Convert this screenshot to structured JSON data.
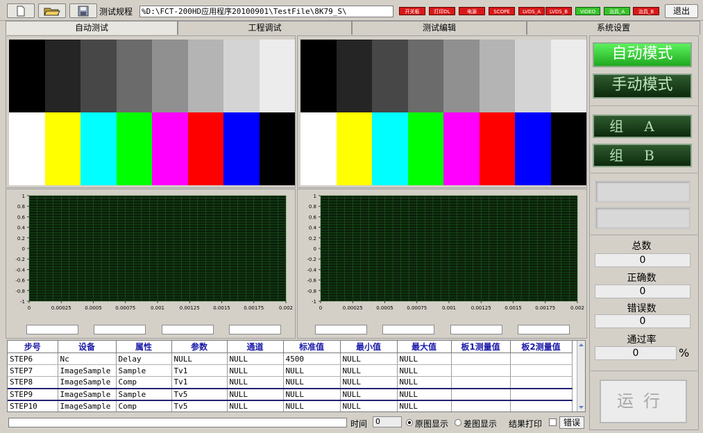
{
  "toolbar": {
    "spec_label": "测试规程",
    "path_value": "%D:\\FCT-200HD应用程序20100901\\TestFile\\8K79_S\\",
    "indicators": [
      "开关板",
      "打印DL",
      "电源",
      "SCOPE",
      "LVDS_A",
      "LVDS_B",
      "VIDEO",
      "治具_A",
      "治具_B"
    ],
    "exit_label": "退出"
  },
  "tabs": [
    "自动测试",
    "工程调试",
    "测试编辑",
    "系统设置"
  ],
  "graph": {
    "y_ticks": [
      "1",
      "0.8",
      "0.6",
      "0.4",
      "0.2",
      "0",
      "-0.2",
      "-0.4",
      "-0.6",
      "-0.8",
      "-1"
    ],
    "x_ticks": [
      "0",
      "0.00025",
      "0.0005",
      "0.00075",
      "0.001",
      "0.00125",
      "0.0015",
      "0.00175",
      "0.002"
    ]
  },
  "right_panel": {
    "auto_mode": "自动模式",
    "manual_mode": "手动模式",
    "group_a": "组A",
    "group_b": "组B",
    "total_label": "总数",
    "total_value": "0",
    "correct_label": "正确数",
    "correct_value": "0",
    "error_label": "错误数",
    "error_value": "0",
    "pass_rate_label": "通过率",
    "pass_rate_value": "0",
    "pass_rate_unit": "%",
    "run_label": "运行"
  },
  "table": {
    "headers": [
      "步号",
      "设备",
      "属性",
      "参数",
      "通道",
      "标准值",
      "最小值",
      "最大值",
      "板1测量值",
      "板2测量值"
    ],
    "rows": [
      [
        "STEP6",
        "Nc",
        "Delay",
        "NULL",
        "NULL",
        "4500",
        "NULL",
        "NULL",
        "",
        ""
      ],
      [
        "STEP7",
        "ImageSample",
        "Sample",
        "Tv1",
        "NULL",
        "NULL",
        "NULL",
        "NULL",
        "",
        ""
      ],
      [
        "STEP8",
        "ImageSample",
        "Comp",
        "Tv1",
        "NULL",
        "NULL",
        "NULL",
        "NULL",
        "",
        ""
      ],
      [
        "STEP9",
        "ImageSample",
        "Sample",
        "Tv5",
        "NULL",
        "NULL",
        "NULL",
        "NULL",
        "",
        ""
      ],
      [
        "STEP10",
        "ImageSample",
        "Comp",
        "Tv5",
        "NULL",
        "NULL",
        "NULL",
        "NULL",
        "",
        ""
      ]
    ],
    "selected_row": 3
  },
  "bottom": {
    "time_label": "时间",
    "time_value": "0",
    "original_display": "原图显示",
    "diff_display": "差图显示",
    "print_result": "结果打印",
    "error_button": "错误"
  },
  "colors": {
    "gray_steps": [
      "#000000",
      "#252525",
      "#474747",
      "#6b6b6b",
      "#909090",
      "#b4b4b4",
      "#d4d4d4",
      "#ececec"
    ],
    "color_bars": [
      "#ffffff",
      "#ffff00",
      "#00ffff",
      "#00ff00",
      "#ff00ff",
      "#ff0000",
      "#0000ff",
      "#000000"
    ],
    "plot_bg": "#0b1f0b",
    "plot_grid": "#1f6a1f"
  }
}
